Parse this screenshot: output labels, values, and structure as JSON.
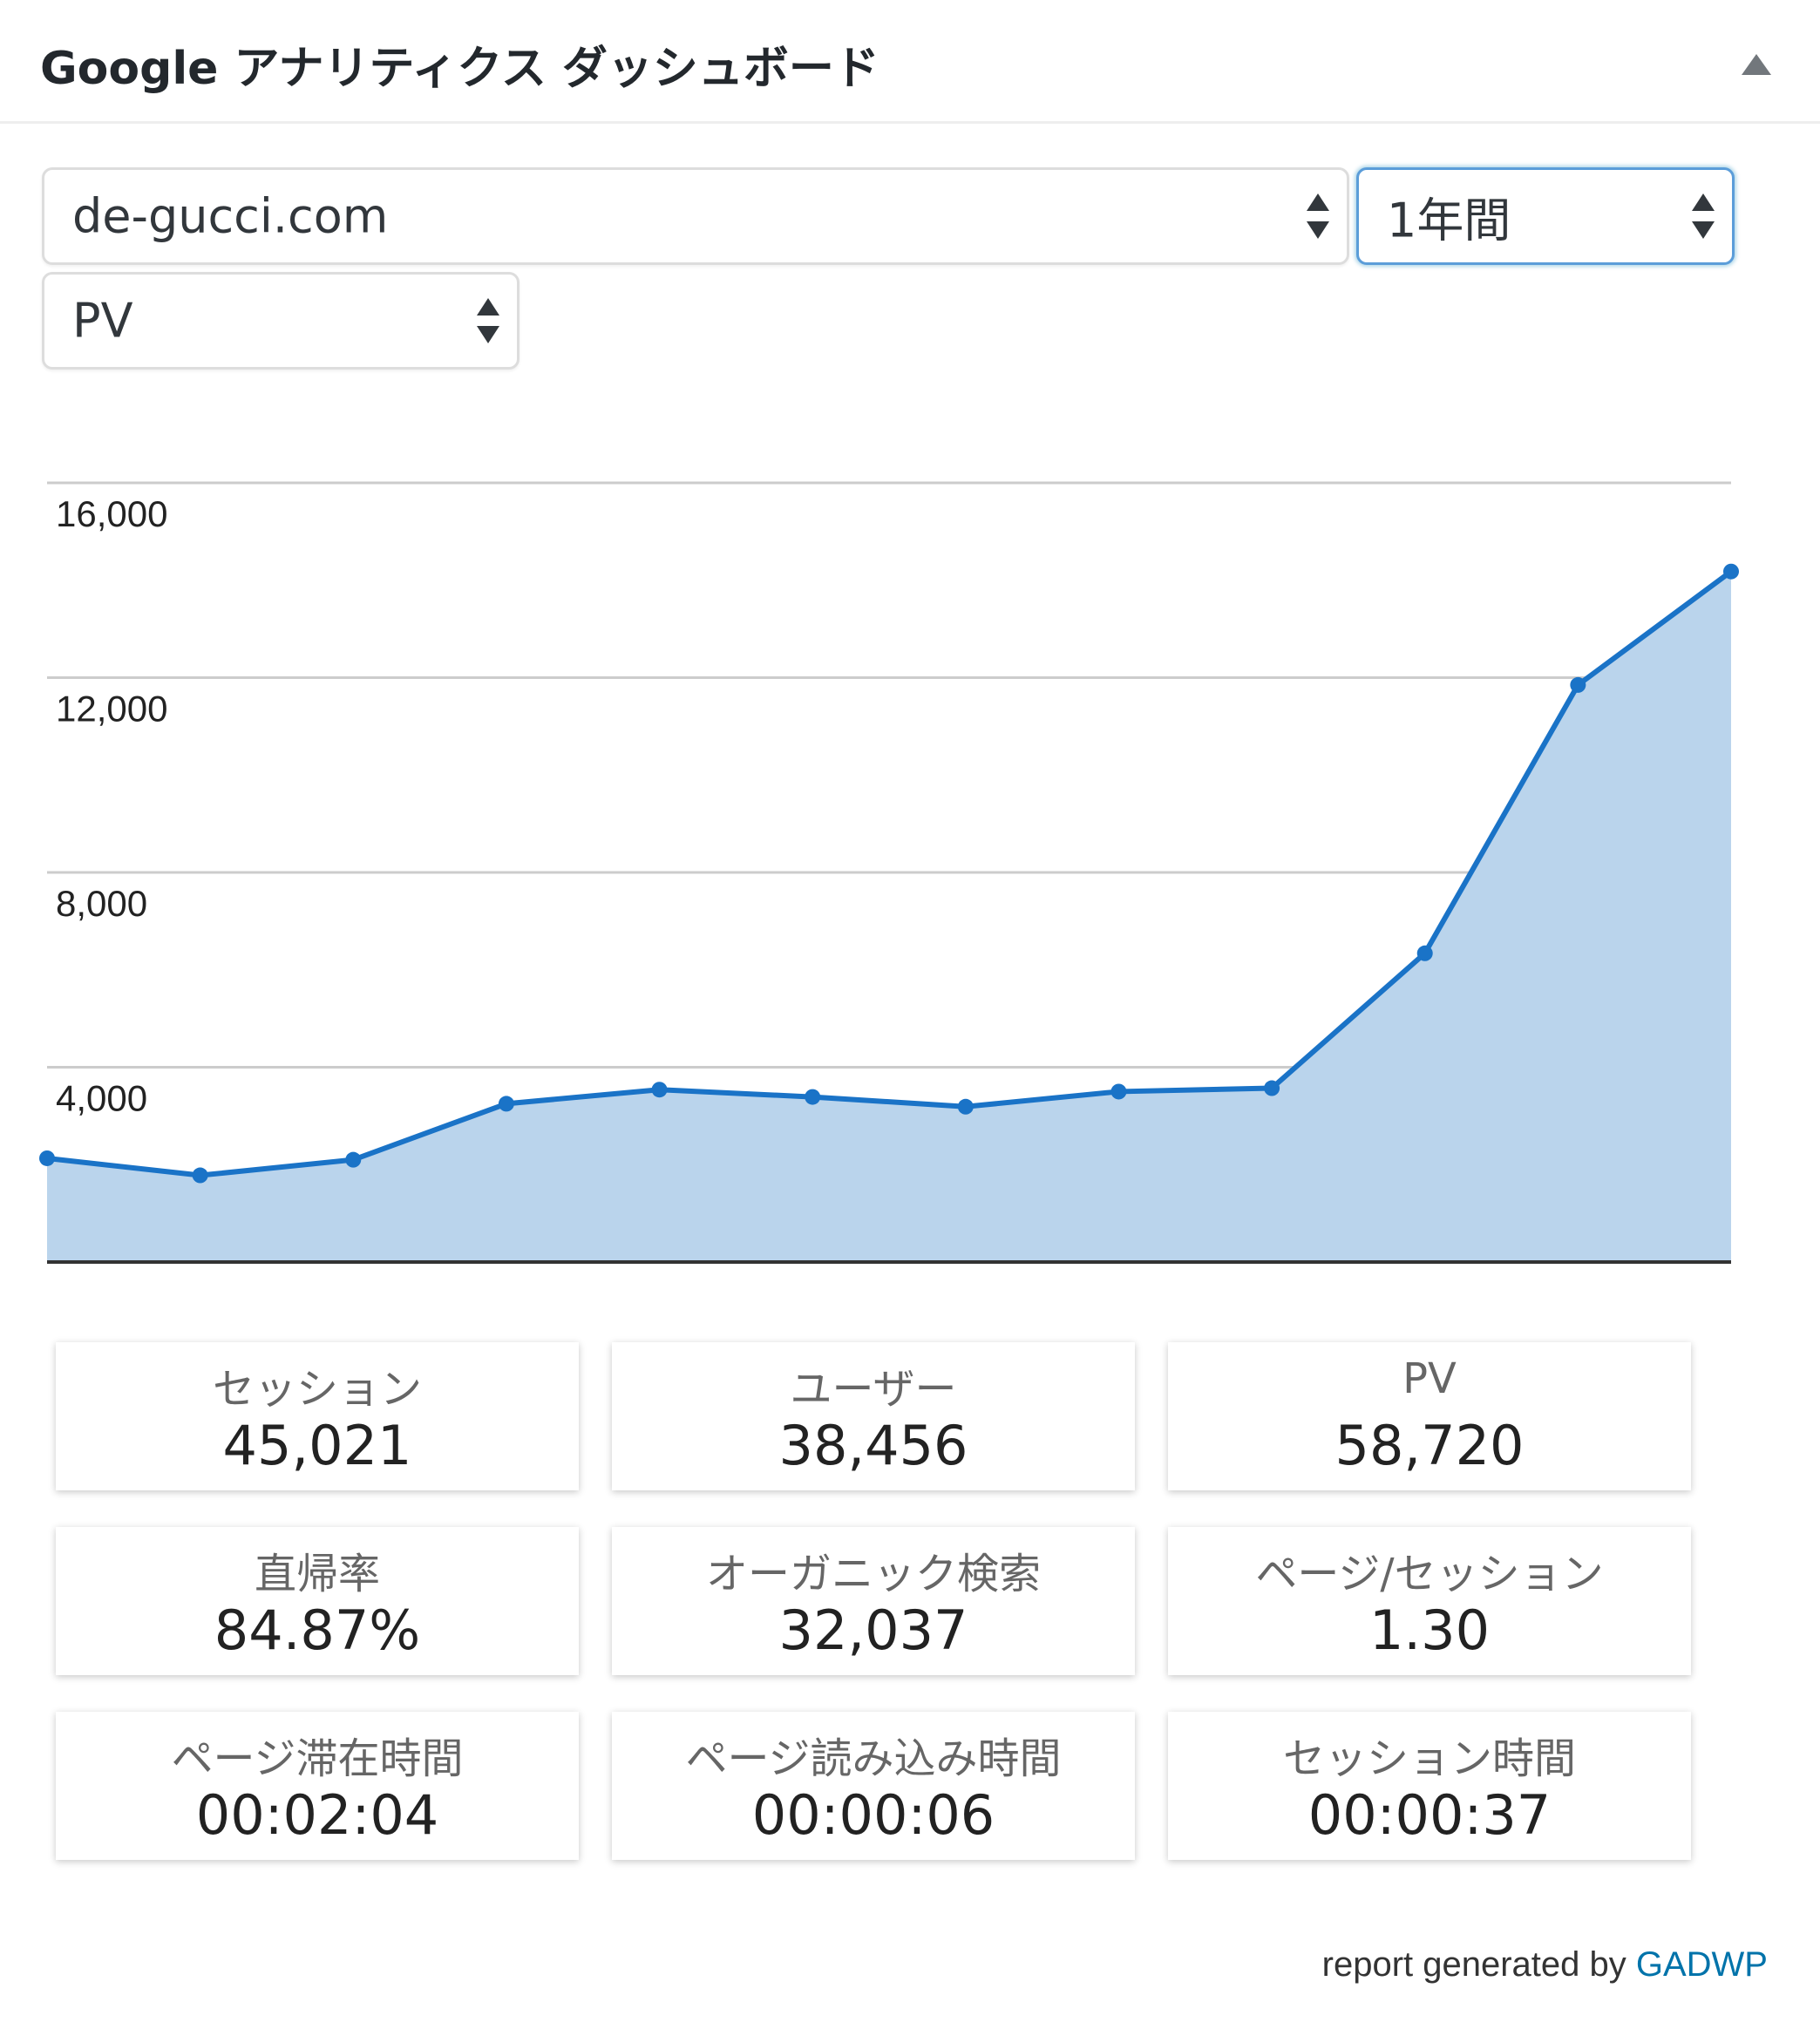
{
  "widget": {
    "title": "Google アナリティクス ダッシュボード"
  },
  "controls": {
    "property_select": {
      "value": "de-gucci.com"
    },
    "period_select": {
      "value": "1年間"
    },
    "metric_select": {
      "value": "PV"
    }
  },
  "chart_data": {
    "type": "area",
    "y_ticks": [
      "16,000",
      "12,000",
      "8,000",
      "4,000"
    ],
    "ylim": [
      0,
      16000
    ],
    "grid": true,
    "series": [
      {
        "values": [
          2130,
          1780,
          2100,
          3250,
          3540,
          3390,
          3190,
          3500,
          3570,
          6340,
          11850,
          14180
        ]
      }
    ],
    "colors": {
      "line": "#1a73c7",
      "fill": "#bad4ec",
      "grid": "#cccccc",
      "axis": "#333333"
    }
  },
  "stats": [
    {
      "label": "セッション",
      "value": "45,021"
    },
    {
      "label": "ユーザー",
      "value": "38,456"
    },
    {
      "label": "PV",
      "value": "58,720"
    },
    {
      "label": "直帰率",
      "value": "84.87%"
    },
    {
      "label": "オーガニック検索",
      "value": "32,037"
    },
    {
      "label": "ページ/セッション",
      "value": "1.30"
    },
    {
      "label": "ページ滞在時間",
      "value": "00:02:04"
    },
    {
      "label": "ページ読み込み時間",
      "value": "00:00:06"
    },
    {
      "label": "セッション時間",
      "value": "00:00:37"
    }
  ],
  "footer": {
    "prefix": "report generated by ",
    "link_label": "GADWP"
  }
}
